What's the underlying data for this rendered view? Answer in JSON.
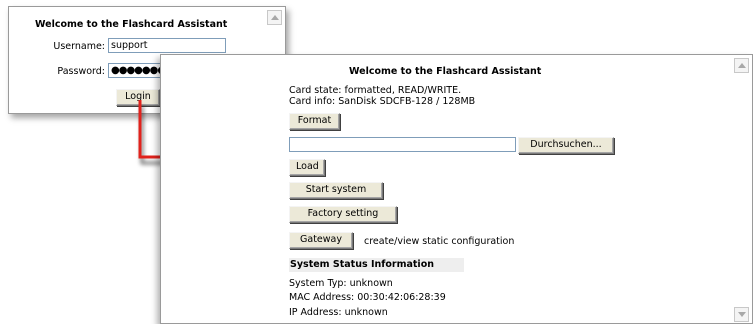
{
  "login_window": {
    "title": "Welcome to the Flashcard Assistant",
    "username_label": "Username:",
    "username_value": "support",
    "password_label": "Password:",
    "password_masked": "●●●●●●●",
    "login_button": "Login"
  },
  "main_window": {
    "title": "Welcome to the Flashcard Assistant",
    "card_state": "Card state: formatted, READ/WRITE.",
    "card_info": "Card info:   SanDisk SDCFB-128 / 128MB",
    "format_button": "Format",
    "file_input_value": "",
    "browse_button": "Durchsuchen...",
    "load_button": "Load",
    "start_system_button": "Start system",
    "factory_setting_button": "Factory setting",
    "gateway_button": "Gateway",
    "gateway_description": "create/view static configuration",
    "status_section_title": "System Status Information",
    "system_typ": "System Typ:   unknown",
    "mac_address": "MAC Address: 00:30:42:06:28:39",
    "ip_address": "IP Address:    unknown"
  },
  "colors": {
    "arrow": "#e0211b",
    "button_face": "#ece9d8",
    "section_bg": "#eeeeee",
    "input_border": "#7f9db9"
  },
  "icons": {
    "arrow": "red-l-arrow",
    "scroll_up": "scroll-up-arrow",
    "scroll_down": "scroll-down-arrow"
  }
}
